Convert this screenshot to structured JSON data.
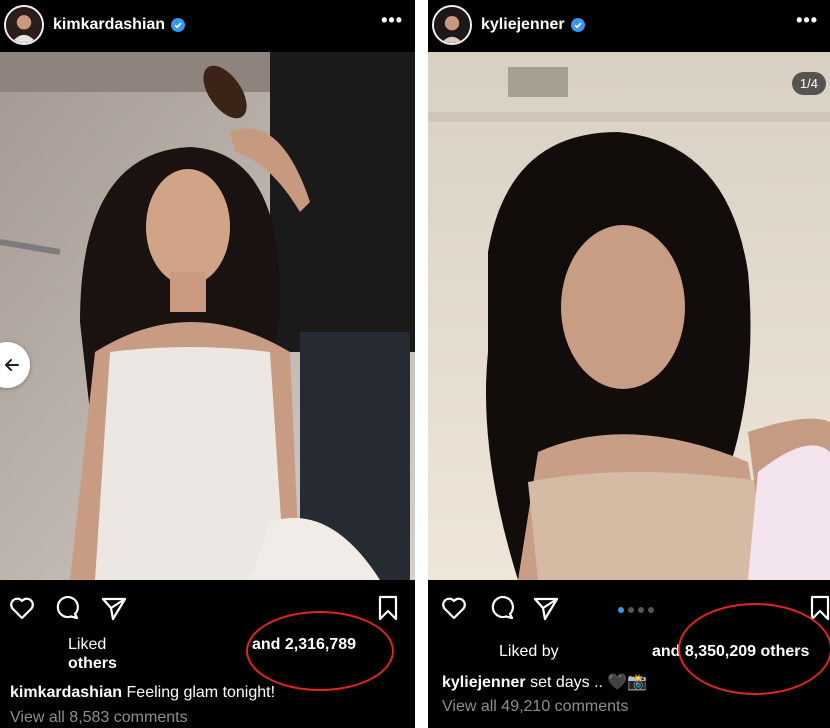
{
  "left_post": {
    "username": "kimkardashian",
    "more": "•••",
    "liked_label": "Liked",
    "others_label": "others",
    "likes": "and 2,316,789",
    "caption_user": "kimkardashian",
    "caption_text": "Feeling glam tonight!",
    "comments": "View all 8,583 comments"
  },
  "right_post": {
    "username": "kyliejenner",
    "more": "•••",
    "counter": "1/4",
    "liked_label": "Liked by",
    "likes": "and 8,350,209 others",
    "caption_user": "kyliejenner",
    "caption_text": "set days .. 🖤📸",
    "comments": "View all 49,210 comments"
  },
  "colors": {
    "background": "#000000",
    "verified": "#3897f0",
    "annotation": "#e0261e",
    "muted_text": "#8e8e8e"
  },
  "icons": {
    "actions": [
      "heart-icon",
      "comment-icon",
      "share-icon",
      "bookmark-icon"
    ],
    "back": "arrow-left-icon"
  }
}
